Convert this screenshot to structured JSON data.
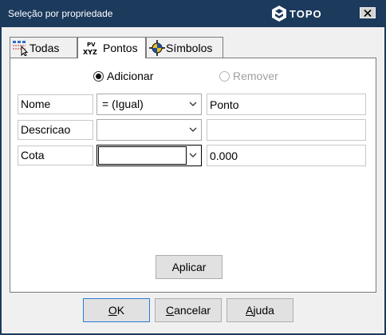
{
  "window": {
    "title": "Seleção por propriedade",
    "logo_text": "TOPO"
  },
  "tabs": [
    {
      "label": "Todas",
      "icon": "select-all-icon"
    },
    {
      "label": "Pontos",
      "icon": "pv-xyz-icon"
    },
    {
      "label": "Símbolos",
      "icon": "crosshair-symbol-icon"
    }
  ],
  "mode": {
    "add_label": "Adicionar",
    "remove_label": "Remover",
    "selected": "Adicionar"
  },
  "properties": [
    {
      "label": "Nome",
      "operator": "= (Igual)",
      "value": ""
    },
    {
      "label": "Descricao",
      "operator": "",
      "value": ""
    },
    {
      "label": "Cota",
      "operator": "",
      "value": "0.000"
    }
  ],
  "properties_values": [
    "Ponto",
    "",
    "0.000"
  ],
  "apply_label": "Aplicar",
  "buttons": {
    "ok": {
      "pre": "",
      "ul": "O",
      "post": "K"
    },
    "cancel": {
      "pre": "",
      "ul": "C",
      "post": "ancelar"
    },
    "help": {
      "pre": "",
      "ul": "A",
      "post": "juda"
    }
  },
  "colors": {
    "titlebar": "#1b3a5c",
    "panel": "#ffffff",
    "dialog": "#f0f0f0",
    "default_button_border": "#2a7bd6"
  }
}
